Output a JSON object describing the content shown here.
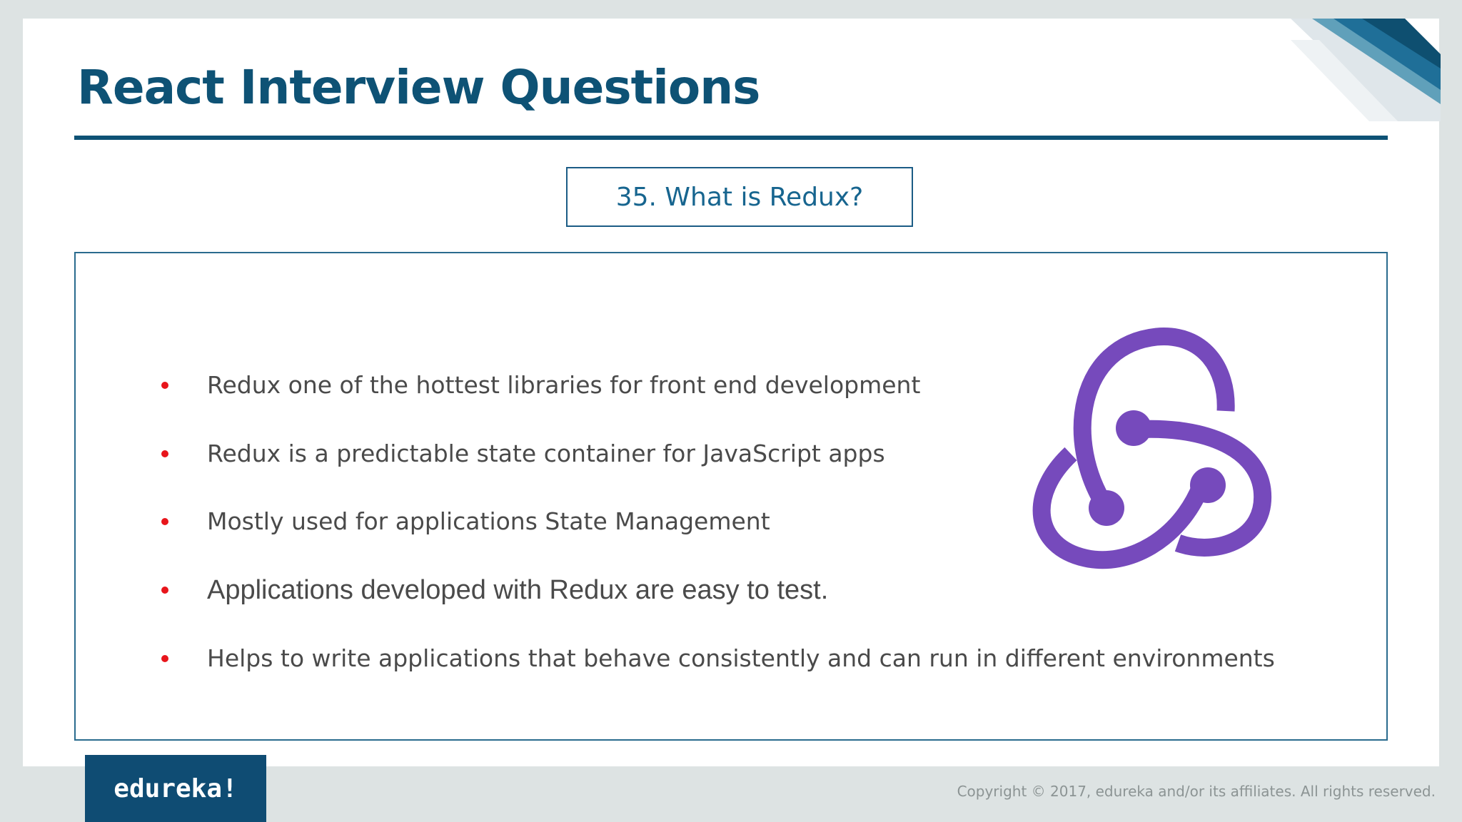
{
  "slide": {
    "title": "React Interview Questions",
    "question": "35. What is Redux?",
    "bullets": [
      "Redux one of the hottest libraries for front end development",
      "Redux is a predictable state container for JavaScript apps",
      "Mostly used for applications State Management",
      "Applications developed with Redux are easy to test.",
      "Helps to write applications that behave consistently and can run in different environments"
    ],
    "logo_icon": "redux-logo-icon"
  },
  "footer": {
    "brand": "edureka!",
    "copyright": "Copyright © 2017, edureka and/or its affiliates. All rights reserved."
  },
  "colors": {
    "title": "#0e5275",
    "question_text": "#17658f",
    "bullet_marker": "#e8151b",
    "body_text": "#4a4a4a",
    "redux_purple": "#764abc",
    "brand_badge": "#0f4c73",
    "background": "#dde3e3"
  }
}
